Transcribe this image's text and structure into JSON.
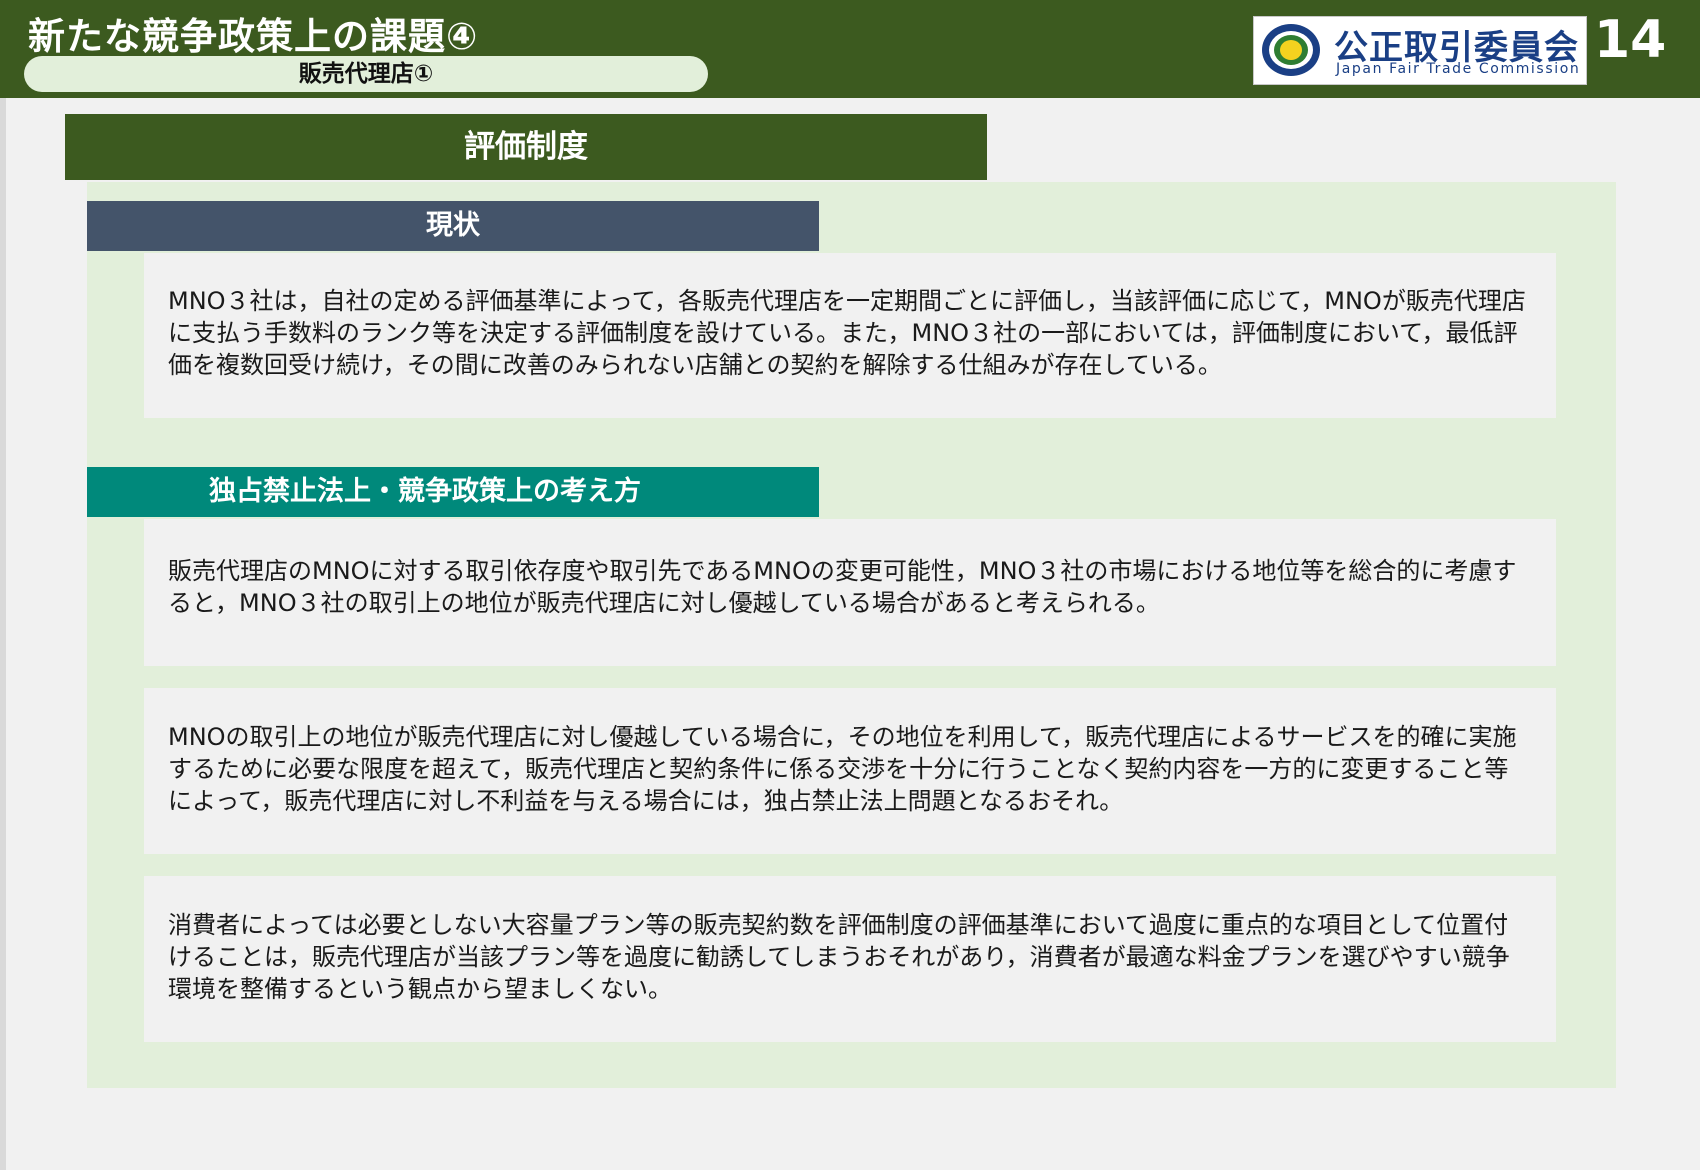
{
  "header": {
    "title": "新たな競争政策上の課題④",
    "subtitle": "販売代理店①",
    "logo": {
      "name_ja": "公正取引委員会",
      "name_en": "Japan Fair Trade Commission"
    },
    "page_number": "14"
  },
  "section": {
    "title": "評価制度",
    "current_status": {
      "label": "現状",
      "text": "MNO３社は，自社の定める評価基準によって，各販売代理店を一定期間ごとに評価し，当該評価に応じて，MNOが販売代理店に支払う手数料のランク等を決定する評価制度を設けている。また，MNO３社の一部においては，評価制度において，最低評価を複数回受け続け，その間に改善のみられない店舗との契約を解除する仕組みが存在している。"
    },
    "view": {
      "label": "独占禁止法上・競争政策上の考え方",
      "paragraphs": [
        "販売代理店のMNOに対する取引依存度や取引先であるMNOの変更可能性，MNO３社の市場における地位等を総合的に考慮すると，MNO３社の取引上の地位が販売代理店に対し優越している場合があると考えられる。",
        "MNOの取引上の地位が販売代理店に対し優越している場合に，その地位を利用して，販売代理店によるサービスを的確に実施するために必要な限度を超えて，販売代理店と契約条件に係る交渉を十分に行うことなく契約内容を一方的に変更すること等によって，販売代理店に対し不利益を与える場合には，独占禁止法上問題となるおそれ。",
        "消費者によっては必要としない大容量プラン等の販売契約数を評価制度の評価基準において過度に重点的な項目として位置付けることは，販売代理店が当該プラン等を過度に勧誘してしまうおそれがあり，消費者が最適な料金プランを選びやすい競争環境を整備するという観点から望ましくない。"
      ]
    }
  },
  "colors": {
    "header_green": "#3c5a1f",
    "panel_green": "#e2efda",
    "status_label": "#44546a",
    "view_label": "#00897b",
    "logo_blue": "#1a3f85"
  }
}
